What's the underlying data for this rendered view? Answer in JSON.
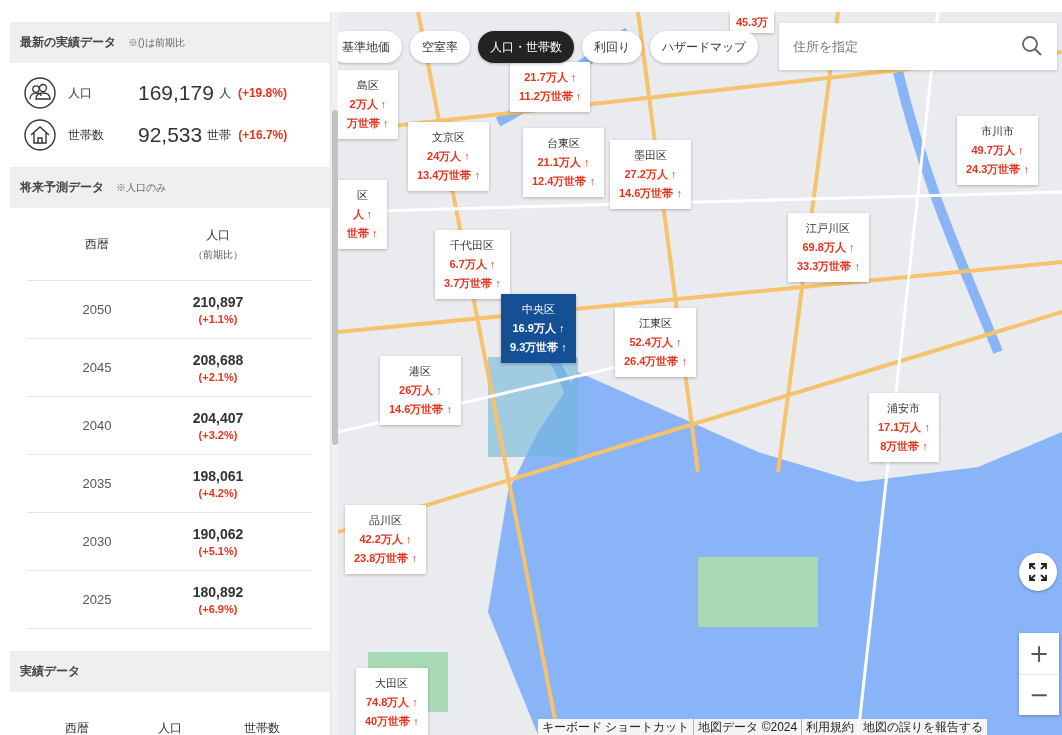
{
  "latest": {
    "title": "最新の実績データ",
    "note": "※()は前期比",
    "stats": [
      {
        "kind": "people",
        "label": "人口",
        "value": "169,179",
        "unit": "人",
        "change": "(+19.8%)"
      },
      {
        "kind": "house",
        "label": "世帯数",
        "value": "92,533",
        "unit": "世帯",
        "change": "(+16.7%)"
      }
    ]
  },
  "forecast": {
    "title": "将来予測データ",
    "note": "※人口のみ",
    "columns": [
      {
        "label": "西暦"
      },
      {
        "label": "人口",
        "sub": "（前期比）"
      }
    ],
    "rows": [
      {
        "year": "2050",
        "population": "210,897",
        "change": "(+1.1%)"
      },
      {
        "year": "2045",
        "population": "208,688",
        "change": "(+2.1%)"
      },
      {
        "year": "2040",
        "population": "204,407",
        "change": "(+3.2%)"
      },
      {
        "year": "2035",
        "population": "198,061",
        "change": "(+4.2%)"
      },
      {
        "year": "2030",
        "population": "190,062",
        "change": "(+5.1%)"
      },
      {
        "year": "2025",
        "population": "180,892",
        "change": "(+6.9%)"
      }
    ]
  },
  "actual": {
    "title": "実績データ",
    "columns": [
      "西暦",
      "人口",
      "世帯数"
    ]
  },
  "map": {
    "layers": [
      {
        "label": "基準地価",
        "selected": false
      },
      {
        "label": "空室率",
        "selected": false
      },
      {
        "label": "人口・世帯数",
        "selected": true
      },
      {
        "label": "利回り",
        "selected": false
      },
      {
        "label": "ハザードマップ",
        "selected": false
      }
    ],
    "search": {
      "placeholder": "住所を指定"
    },
    "markers": [
      {
        "population": "45.3万",
        "selected": false
      },
      {
        "population": "21.7万人 ↑",
        "households": "11.2万世帯 ↑",
        "selected": false
      },
      {
        "name": "島区",
        "population": "2万人 ↑",
        "households": "万世帯 ↑",
        "selected": false
      },
      {
        "name": "区",
        "population": "人 ↑",
        "households": "世帯 ↑",
        "selected": false
      },
      {
        "name": "文京区",
        "population": "24万人 ↑",
        "households": "13.4万世帯 ↑",
        "selected": false
      },
      {
        "name": "台東区",
        "population": "21.1万人 ↑",
        "households": "12.4万世帯 ↑",
        "selected": false
      },
      {
        "name": "墨田区",
        "population": "27.2万人 ↑",
        "households": "14.6万世帯 ↑",
        "selected": false
      },
      {
        "name": "市川市",
        "population": "49.7万人 ↑",
        "households": "24.3万世帯 ↑",
        "selected": false
      },
      {
        "name": "江戸川区",
        "population": "69.8万人 ↑",
        "households": "33.3万世帯 ↑",
        "selected": false
      },
      {
        "name": "千代田区",
        "population": "6.7万人 ↑",
        "households": "3.7万世帯 ↑",
        "selected": false
      },
      {
        "name": "中央区",
        "population": "16.9万人 ↑",
        "households": "9.3万世帯 ↑",
        "selected": true
      },
      {
        "name": "江東区",
        "population": "52.4万人 ↑",
        "households": "26.4万世帯 ↑",
        "selected": false
      },
      {
        "name": "港区",
        "population": "26万人 ↑",
        "households": "14.6万世帯 ↑",
        "selected": false
      },
      {
        "name": "浦安市",
        "population": "17.1万人 ↑",
        "households": "8万世帯 ↑",
        "selected": false
      },
      {
        "name": "品川区",
        "population": "42.2万人 ↑",
        "households": "23.8万世帯 ↑",
        "selected": false
      },
      {
        "name": "大田区",
        "population": "74.8万人 ↑",
        "households": "40万世帯 ↑",
        "selected": false
      }
    ],
    "zoom": [
      "+",
      "−"
    ],
    "attribution": [
      "キーボード ショートカット",
      "地図データ ©2024",
      "利用規約",
      "地図の誤りを報告する"
    ]
  }
}
